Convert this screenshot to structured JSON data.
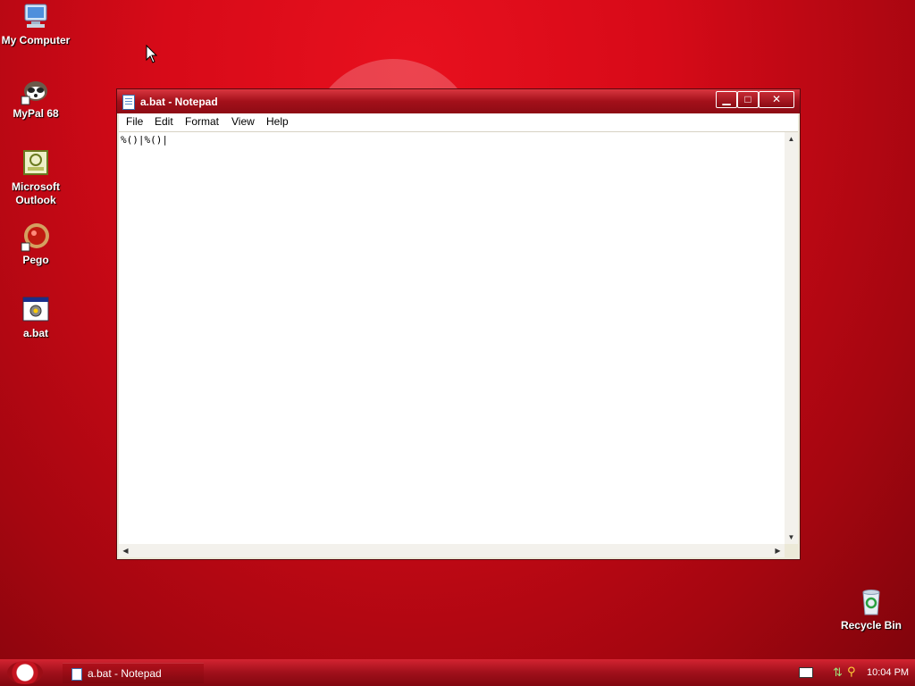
{
  "desktop": {
    "icons": [
      {
        "label": "My Computer",
        "icon": "my-computer-icon"
      },
      {
        "label": "MyPal 68",
        "icon": "mypal-browser-icon"
      },
      {
        "label": "Microsoft Outlook",
        "icon": "outlook-icon"
      },
      {
        "label": "Pego",
        "icon": "pego-icon"
      },
      {
        "label": "a.bat",
        "icon": "batch-file-icon"
      },
      {
        "label": "Recycle Bin",
        "icon": "recycle-bin-icon"
      }
    ]
  },
  "window": {
    "title": "a.bat - Notepad",
    "controls": {
      "minimize": "minimize-icon",
      "maximize": "maximize-icon",
      "close": "close-icon"
    },
    "menu": [
      "File",
      "Edit",
      "Format",
      "View",
      "Help"
    ],
    "content": "%()|%()|"
  },
  "taskbar": {
    "task_label": "a.bat - Notepad",
    "clock": "10:04 PM"
  },
  "colors": {
    "accent": "#d70a18",
    "titlebar": "#a3101a"
  }
}
